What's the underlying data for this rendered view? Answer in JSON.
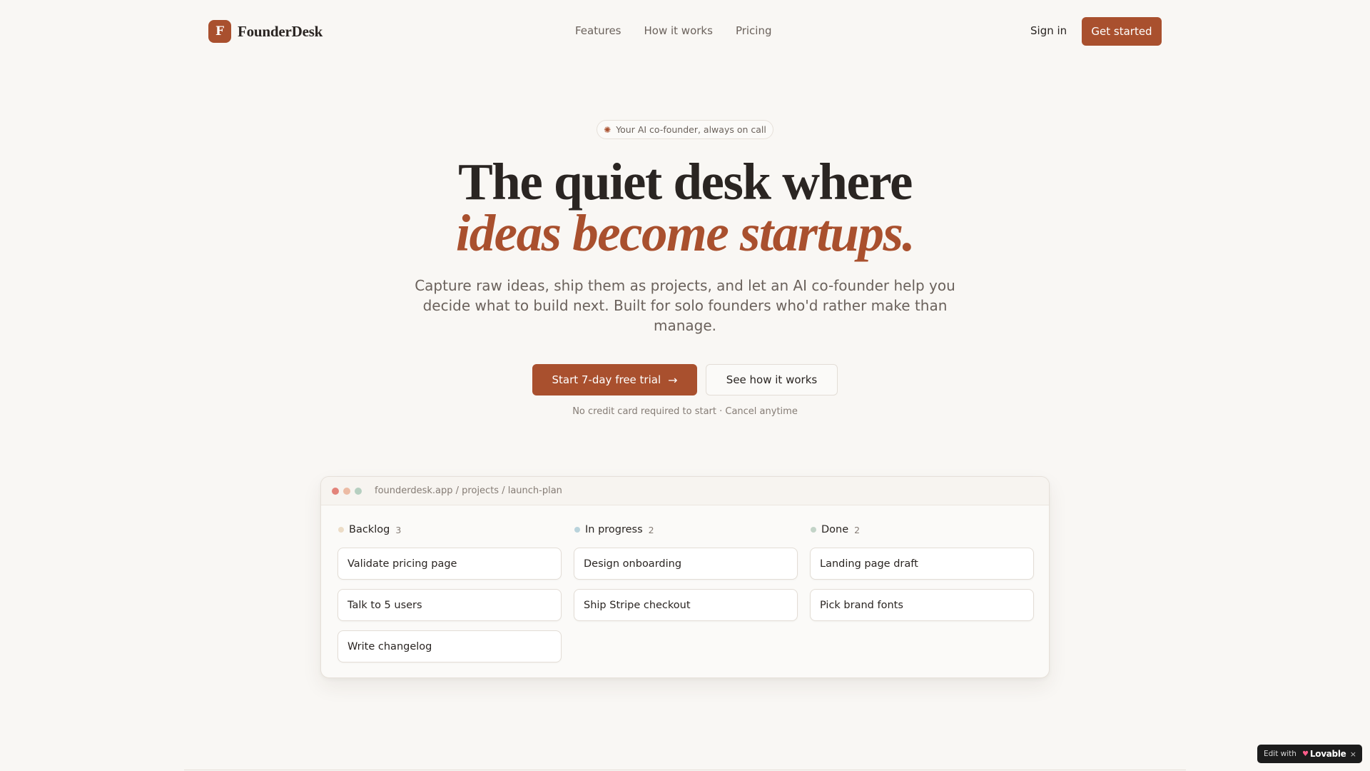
{
  "brand": {
    "mark": "F",
    "name": "FounderDesk",
    "accent": "#a9502e"
  },
  "nav": {
    "links": [
      "Features",
      "How it works",
      "Pricing"
    ],
    "signin": "Sign in",
    "cta": "Get started"
  },
  "hero": {
    "pill": "Your AI co-founder, always on call",
    "pill_icon": "sparkle-icon",
    "headline_line1": "The quiet desk where",
    "headline_line2": "ideas become startups.",
    "subtitle": "Capture raw ideas, ship them as projects, and let an AI co-founder help you decide what to build next. Built for solo founders who'd rather make than manage.",
    "cta_primary": "Start 7-day free trial",
    "cta_primary_icon": "arrow-right-icon",
    "cta_secondary": "See how it works",
    "note": "No credit card required to start · Cancel anytime"
  },
  "preview": {
    "url": "founderdesk.app / projects / launch-plan",
    "columns": [
      {
        "title": "Backlog",
        "count": "3",
        "dot_color": "#ecdcc6",
        "cards": [
          "Validate pricing page",
          "Talk to 5 users",
          "Write changelog"
        ]
      },
      {
        "title": "In progress",
        "count": "2",
        "dot_color": "#b9d3dc",
        "cards": [
          "Design onboarding",
          "Ship Stripe checkout"
        ]
      },
      {
        "title": "Done",
        "count": "2",
        "dot_color": "#c3d4c8",
        "cards": [
          "Landing page draft",
          "Pick brand fonts"
        ]
      }
    ]
  },
  "badge": {
    "prefix": "Edit with",
    "brand": "Lovable",
    "close": "×"
  }
}
